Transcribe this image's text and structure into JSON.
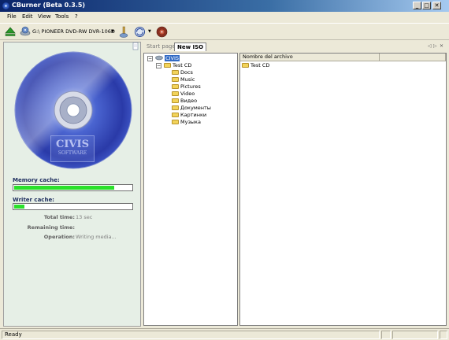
{
  "window": {
    "title": "CBurner (Beta 0.3.5)",
    "min": "_",
    "max": "□",
    "close": "✕"
  },
  "menu": [
    "File",
    "Edit",
    "View",
    "Tools",
    "?"
  ],
  "toolbar": {
    "drive": "G:\\ PIONEER DVD-RW  DVR-106D",
    "drive_arrow": "▼",
    "burn_arrow": "▼"
  },
  "tabs": {
    "start": "Start page",
    "new_iso": "New ISO",
    "nav_prev": "◁",
    "nav_next": "▷",
    "nav_close": "✕"
  },
  "disc": {
    "logo_line1": "CIVIS",
    "logo_line2": "SOFTWARE"
  },
  "left": {
    "memory_cache_label": "Memory cache:",
    "memory_cache_level": 0.85,
    "writer_cache_label": "Writer cache:",
    "writer_cache_level": 0.09,
    "total_time_label": "Total time:",
    "total_time_value": "13 sec",
    "remaining_time_label": "Remaining time:",
    "remaining_time_value": "",
    "operation_label": "Operation:",
    "operation_value": "Writing media..."
  },
  "tree": {
    "root": "CIVIS",
    "project": "Test CD",
    "folders": [
      "Docs",
      "Music",
      "Pictures",
      "Video",
      "Видео",
      "Документы",
      "Картинки",
      "Музыка"
    ],
    "root_toggle": "−",
    "project_toggle": "−"
  },
  "files": {
    "column": "Nombre del archivo",
    "items": [
      "Test CD"
    ]
  },
  "status": {
    "text": "Ready"
  }
}
